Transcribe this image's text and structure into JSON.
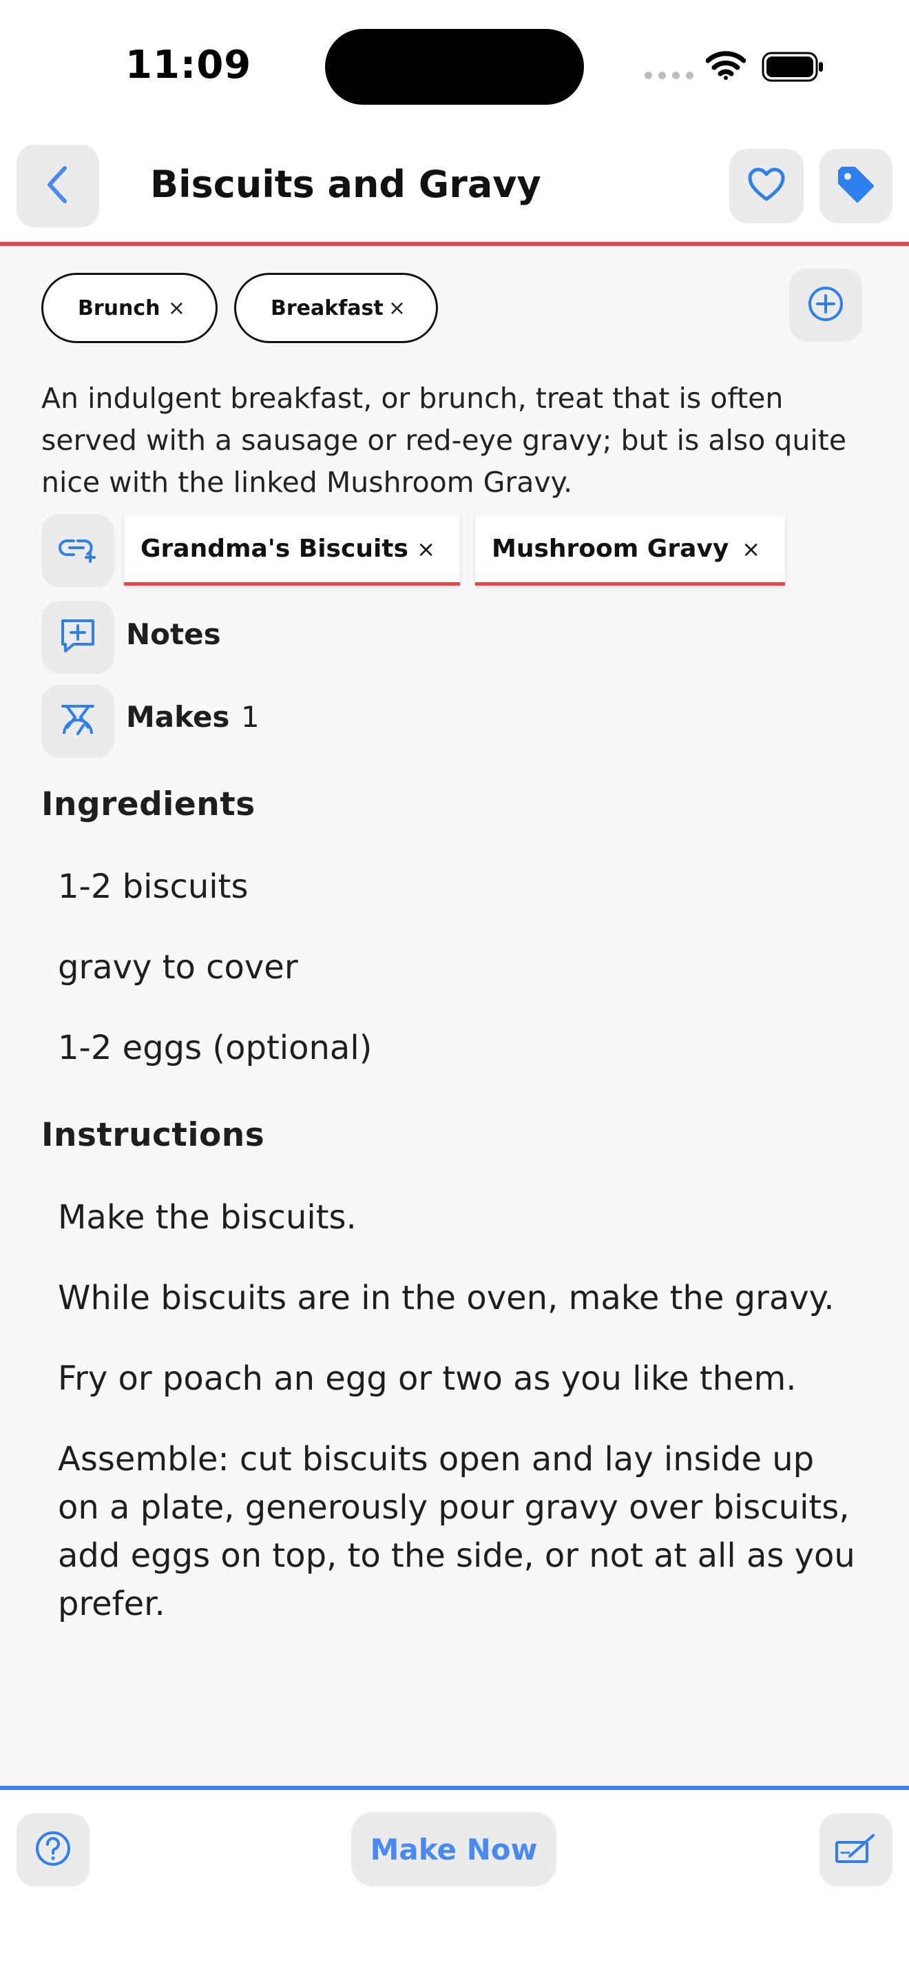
{
  "status_bar": {
    "time": "11:09"
  },
  "header": {
    "title": "Biscuits and Gravy",
    "back_icon": "chevron-left-icon",
    "favorite_icon": "heart-icon",
    "tag_icon": "tag-icon"
  },
  "tags": [
    {
      "label": "Brunch",
      "remove": "×"
    },
    {
      "label": "Breakfast",
      "remove": "×"
    }
  ],
  "add_tag_icon": "plus-circle-icon",
  "description": "An indulgent breakfast, or brunch, treat that is often served with a sausage or red-eye gravy; but is also quite nice with the linked Mushroom Gravy.",
  "linked_recipes": [
    {
      "label": "Grandma's Biscuits",
      "remove": "×"
    },
    {
      "label": "Mushroom Gravy",
      "remove": "×"
    }
  ],
  "notes": {
    "label": "Notes",
    "icon": "add-note-icon"
  },
  "makes": {
    "label": "Makes",
    "value": "1",
    "icon": "scale-icon"
  },
  "ingredients": {
    "title": "Ingredients",
    "items": [
      "1-2 biscuits",
      "gravy to cover",
      "1-2 eggs (optional)"
    ]
  },
  "instructions": {
    "title": "Instructions",
    "steps": [
      "Make the biscuits.",
      "While biscuits are in the oven, make the gravy.",
      "Fry or poach an egg or two as you like them.",
      "Assemble: cut biscuits open and lay inside up on a plate, generously pour gravy over biscuits, add eggs on top, to the side, or not at all as you prefer."
    ]
  },
  "bottom_bar": {
    "make_now_label": "Make Now",
    "help_icon": "help-circle-icon",
    "edit_icon": "edit-icon"
  },
  "colors": {
    "accent_blue": "#3B82F6",
    "accent_red": "#E8454B",
    "button_gray": "#EBEBEB",
    "background": "#F8F8F8"
  }
}
